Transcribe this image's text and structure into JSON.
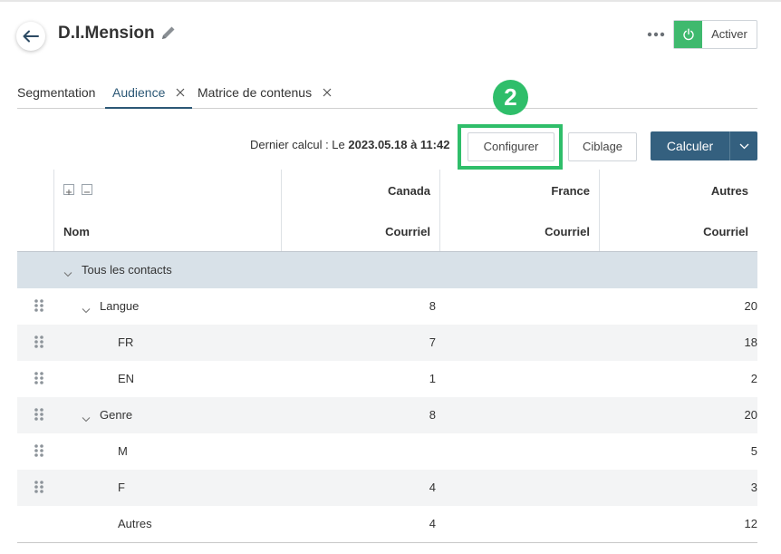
{
  "header": {
    "title": "D.I.Mension",
    "activate_label": "Activer",
    "accent_color": "#3fb96e"
  },
  "tabs": [
    {
      "label": "Segmentation",
      "active": false,
      "closable": false
    },
    {
      "label": "Audience",
      "active": true,
      "closable": true
    },
    {
      "label": "Matrice de contenus",
      "active": false,
      "closable": true
    }
  ],
  "step_badge": "2",
  "toolbar": {
    "last_calc_prefix": "Dernier calcul : Le",
    "last_calc_date": "2023.05.18 à 11:42",
    "configure_label": "Configurer",
    "targeting_label": "Ciblage",
    "calculate_label": "Calculer",
    "calculate_color": "#34607f"
  },
  "table": {
    "name_header": "Nom",
    "columns": [
      {
        "country": "Canada",
        "channel": "Courriel"
      },
      {
        "country": "France",
        "channel": "Courriel"
      },
      {
        "country": "Autres",
        "channel": "Courriel"
      }
    ],
    "rows": [
      {
        "label": "Tous les contacts",
        "level": 0,
        "expandable": true,
        "draggable": false,
        "values": [
          "",
          "",
          ""
        ]
      },
      {
        "label": "Langue",
        "level": 1,
        "expandable": true,
        "draggable": true,
        "values": [
          "8",
          "",
          "20"
        ]
      },
      {
        "label": "FR",
        "level": 2,
        "expandable": false,
        "draggable": true,
        "values": [
          "7",
          "",
          "18"
        ]
      },
      {
        "label": "EN",
        "level": 2,
        "expandable": false,
        "draggable": true,
        "values": [
          "1",
          "",
          "2"
        ]
      },
      {
        "label": "Genre",
        "level": 1,
        "expandable": true,
        "draggable": true,
        "values": [
          "8",
          "",
          "20"
        ]
      },
      {
        "label": "M",
        "level": 2,
        "expandable": false,
        "draggable": true,
        "values": [
          "",
          "",
          "5"
        ]
      },
      {
        "label": "F",
        "level": 2,
        "expandable": false,
        "draggable": true,
        "values": [
          "4",
          "",
          "3"
        ]
      },
      {
        "label": "Autres",
        "level": 2,
        "expandable": false,
        "draggable": false,
        "values": [
          "4",
          "",
          "12"
        ]
      }
    ]
  }
}
